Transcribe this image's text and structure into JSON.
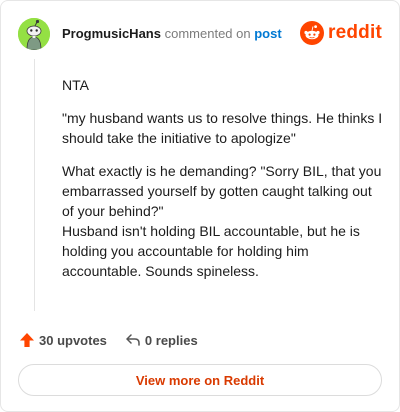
{
  "header": {
    "username": "ProgmusicHans",
    "action_text": "commented on",
    "post_link": "post",
    "brand": "reddit"
  },
  "comment": {
    "paragraphs": [
      "NTA",
      "\"my husband wants us to resolve things. He thinks I should take the initiative to apologize\"",
      "What exactly is he demanding? \"Sorry BIL, that you embarrassed yourself by gotten caught talking out of your behind?\"",
      "Husband isn't holding BIL accountable, but he is holding you accountable for holding him accountable. Sounds spineless."
    ]
  },
  "actions": {
    "upvotes": "30 upvotes",
    "replies": "0 replies"
  },
  "footer": {
    "view_more": "View more on Reddit"
  },
  "colors": {
    "accent": "#ff4500",
    "link": "#0079d3",
    "avatar_bg": "#94e044",
    "view_more_text": "#d93a00"
  },
  "icons": {
    "avatar": "snoo-avatar-icon",
    "brand": "reddit-logo-icon",
    "upvote": "upvote-arrow-icon",
    "reply": "reply-arrow-icon"
  }
}
